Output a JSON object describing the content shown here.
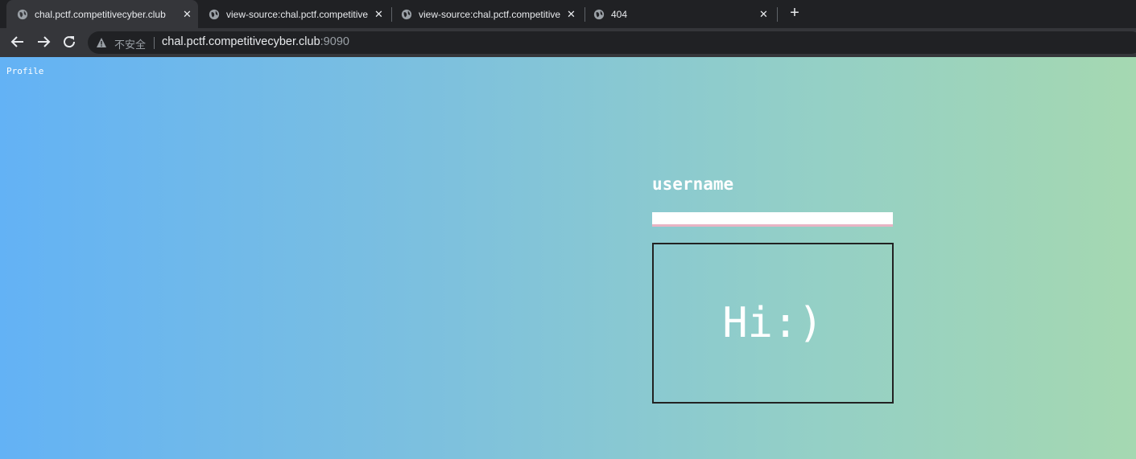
{
  "browser": {
    "tabs": [
      {
        "title": "chal.pctf.competitivecyber.club",
        "active": true
      },
      {
        "title": "view-source:chal.pctf.competitivecyber.club",
        "active": false
      },
      {
        "title": "view-source:chal.pctf.competitivecyber.club",
        "active": false
      },
      {
        "title": "404",
        "active": false
      }
    ],
    "close_glyph": "✕",
    "new_tab_glyph": "+",
    "security_label": "不安全",
    "url_host": "chal.pctf.competitivecyber.club",
    "url_port": ":9090",
    "colors": {
      "tabstrip": "#202124",
      "toolbar": "#35363a",
      "text": "#e8eaed"
    }
  },
  "page": {
    "profile_link": "Profile",
    "username_label": "username",
    "username_value": "",
    "greeting": "Hi:)",
    "colors": {
      "gradient_start": "#63b2f5",
      "gradient_end": "#a5d8b1",
      "text": "#ffffff"
    }
  }
}
